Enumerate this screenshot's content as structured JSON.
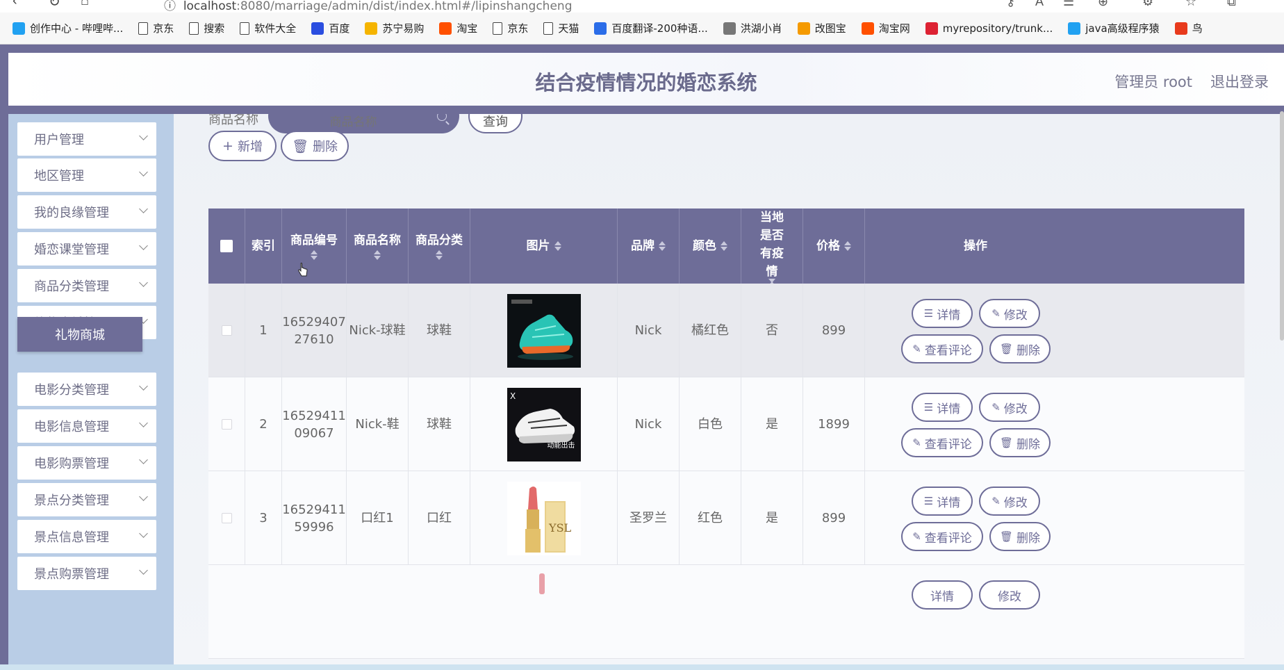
{
  "browser": {
    "url_host": "localhost",
    "url_rest": ":8080/marriage/admin/dist/index.html#/lipinshangcheng",
    "bookmarks": [
      {
        "label": "创作中心 - 哔哩哔...",
        "icon": "bilibili-icon",
        "color": "#21a1f1"
      },
      {
        "label": "京东",
        "icon": "file-icon",
        "color": ""
      },
      {
        "label": "搜索",
        "icon": "file-icon",
        "color": ""
      },
      {
        "label": "软件大全",
        "icon": "file-icon",
        "color": ""
      },
      {
        "label": "百度",
        "icon": "baidu-paw-icon",
        "color": "#2b4ee0"
      },
      {
        "label": "苏宁易购",
        "icon": "suning-icon",
        "color": "#f5b400"
      },
      {
        "label": "淘宝",
        "icon": "taobao-icon",
        "color": "#ff5000"
      },
      {
        "label": "京东",
        "icon": "file-icon",
        "color": ""
      },
      {
        "label": "天猫",
        "icon": "file-icon",
        "color": ""
      },
      {
        "label": "百度翻译-200种语...",
        "icon": "translate-icon",
        "color": "#2b6de8"
      },
      {
        "label": "洪湖小肖",
        "icon": "bird-icon",
        "color": "#777"
      },
      {
        "label": "改图宝",
        "icon": "gaitubao-icon",
        "color": "#f59a00"
      },
      {
        "label": "淘宝网",
        "icon": "taobao-icon",
        "color": "#ff5000"
      },
      {
        "label": "myrepository/trunk...",
        "icon": "chrome-icon",
        "color": "#d23"
      },
      {
        "label": "java高级程序猿",
        "icon": "bilibili-icon",
        "color": "#21a1f1"
      },
      {
        "label": "鸟",
        "icon": "swift-bird-icon",
        "color": "#e83a1c"
      }
    ]
  },
  "header": {
    "title": "结合疫情情况的婚恋系统",
    "admin": "管理员 root",
    "logout": "退出登录"
  },
  "sidebar": {
    "items": [
      {
        "label": "用户管理"
      },
      {
        "label": "地区管理"
      },
      {
        "label": "我的良缘管理"
      },
      {
        "label": "婚恋课堂管理"
      },
      {
        "label": "商品分类管理"
      },
      {
        "label": "礼物商城管理"
      },
      {
        "label": "电影分类管理"
      },
      {
        "label": "电影信息管理"
      },
      {
        "label": "电影购票管理"
      },
      {
        "label": "景点分类管理"
      },
      {
        "label": "景点信息管理"
      },
      {
        "label": "景点购票管理"
      }
    ],
    "active_sub": "礼物商城"
  },
  "search": {
    "label": "商品名称",
    "placeholder": "商品名称",
    "query_button": "查询"
  },
  "actions": {
    "add": "新增",
    "delete": "删除"
  },
  "table": {
    "columns": [
      "索引",
      "商品编号",
      "商品名称",
      "商品分类",
      "图片",
      "品牌",
      "颜色",
      "当地是否有疫情",
      "价格",
      "操作"
    ],
    "rows": [
      {
        "index": "1",
        "code_a": "16529407",
        "code_b": "27610",
        "name": "Nick-球鞋",
        "category": "球鞋",
        "brand": "Nick",
        "color": "橘红色",
        "epidemic": "否",
        "price": "899",
        "image": "teal-basketball-shoe",
        "image_text": ""
      },
      {
        "index": "2",
        "code_a": "16529411",
        "code_b": "09067",
        "name": "Nick-鞋",
        "category": "球鞋",
        "brand": "Nick",
        "color": "白色",
        "epidemic": "是",
        "price": "1899",
        "image": "white-running-shoe",
        "image_text": "动能出击"
      },
      {
        "index": "3",
        "code_a": "16529411",
        "code_b": "59996",
        "name": "口红1",
        "category": "口红",
        "brand": "圣罗兰",
        "color": "红色",
        "epidemic": "是",
        "price": "899",
        "image": "red-lipstick",
        "image_text": ""
      }
    ],
    "op_labels": {
      "detail": "详情",
      "edit": "修改",
      "comments": "查看评论",
      "delete": "删除"
    }
  },
  "colors": {
    "accent": "#6e6d98",
    "sidebar_bg": "#b9cde6"
  }
}
